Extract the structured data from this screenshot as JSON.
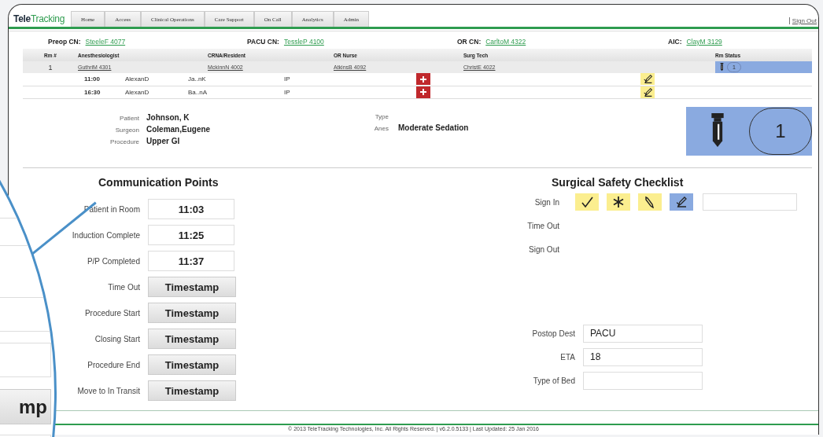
{
  "logo": "**Tele**Tracking",
  "nav_tabs": [
    {
      "label": "Home",
      "selected": false
    },
    {
      "label": "Access",
      "selected": false
    },
    {
      "label": "Clinical Operations",
      "selected": false
    },
    {
      "label": "Care Support",
      "selected": false
    },
    {
      "label": "On Call",
      "selected": false
    },
    {
      "label": "Analytics",
      "selected": false
    },
    {
      "label": "Admin",
      "selected": false
    }
  ],
  "sign_out": "Sign Out",
  "charge_nurses": [
    {
      "label": "Preop CN:",
      "name": "SteeleF 4077"
    },
    {
      "label": "PACU CN:",
      "name": "TessleP 4100"
    },
    {
      "label": "OR CN:",
      "name": "CarltoM 4322"
    },
    {
      "label": "AIC:",
      "name": "ClayM 3129"
    }
  ],
  "table": {
    "columns": [
      "Rm #",
      "Anesthesiologist",
      "CRNA/Resident",
      "OR Nurse",
      "Surg Tech",
      "Rm Status"
    ],
    "room": {
      "number": "1",
      "anesthesiologist": "GuthriM 4301",
      "crna": "MckinnN 4002",
      "or_nurse": "AtkinsB 4092",
      "surg_tech": "ChristE 4022",
      "status_count": "1",
      "selected": true
    },
    "cases": [
      {
        "time": "11:00",
        "anesthesiologist": "AlexanD",
        "crna": "Ja..nK",
        "type": "IP"
      },
      {
        "time": "16:30",
        "anesthesiologist": "AlexanD",
        "crna": "Ba..nA",
        "type": "IP"
      }
    ]
  },
  "patient": {
    "fields_left": [
      {
        "label": "Patient",
        "value": "Johnson, K"
      },
      {
        "label": "Surgeon",
        "value": "Coleman,Eugene"
      },
      {
        "label": "Procedure",
        "value": "Upper GI"
      }
    ],
    "fields_right": [
      {
        "label": "Type"
      },
      {
        "label": "Anes",
        "value": "Moderate Sedation"
      }
    ],
    "status_count": "1"
  },
  "communication_points": {
    "title": "Communication Points",
    "rows": [
      {
        "label": "Patient in Room",
        "kind": "time",
        "value": "11:03"
      },
      {
        "label": "Induction Complete",
        "kind": "time",
        "value": "11:25"
      },
      {
        "label": "P/P Completed",
        "kind": "time",
        "value": "11:37"
      },
      {
        "label": "Time Out",
        "kind": "button",
        "value": "Timestamp"
      },
      {
        "label": "Procedure Start",
        "kind": "button",
        "value": "Timestamp"
      },
      {
        "label": "Closing Start",
        "kind": "button",
        "value": "Timestamp"
      },
      {
        "label": "Procedure End",
        "kind": "button",
        "value": "Timestamp"
      },
      {
        "label": "Move to In Transit",
        "kind": "button",
        "value": "Timestamp"
      }
    ]
  },
  "checklist": {
    "title": "Surgical Safety Checklist",
    "phases": [
      {
        "label": "Sign In",
        "tiles": [
          {
            "kind": "check",
            "color": "#fbee8f"
          },
          {
            "kind": "asterisk",
            "color": "#fbee8f"
          },
          {
            "kind": "pen",
            "color": "#fbee8f"
          },
          {
            "kind": "sign",
            "color": "#8aaae0"
          }
        ],
        "has_field": true
      },
      {
        "label": "Time Out",
        "has_field": false
      },
      {
        "label": "Sign Out",
        "has_field": false
      }
    ]
  },
  "postop": [
    {
      "label": "Postop Dest",
      "value": "PACU"
    },
    {
      "label": "ETA",
      "value": "18"
    },
    {
      "label": "Type of Bed"
    }
  ],
  "footer": "© 2013 TeleTracking Technologies, Inc. All Rights Reserved. | v6.2.0.5133 | Last Updated: 25 Jan 2016",
  "magnifier": {
    "button_fragment": "mp"
  }
}
